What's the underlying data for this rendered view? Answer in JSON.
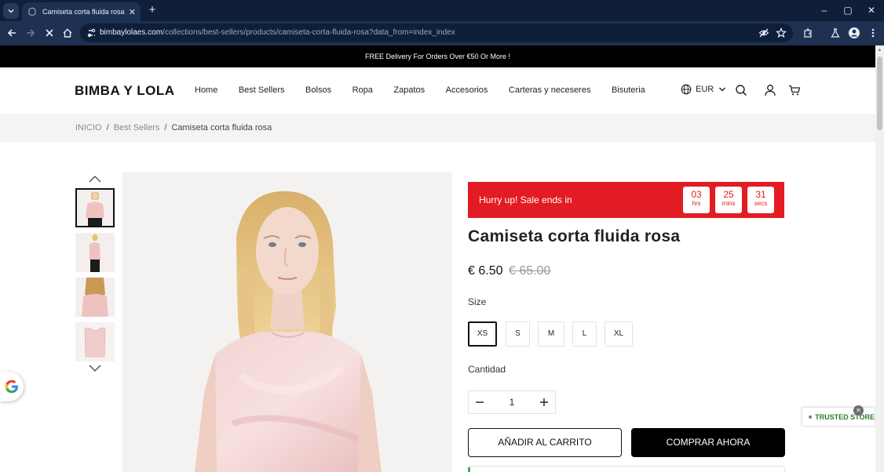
{
  "browser": {
    "tab_title": "Camiseta corta fluida rosa",
    "url_domain": "bimbaylolaes.com",
    "url_path": "/collections/best-sellers/products/camiseta-corta-fluida-rosa?data_from=index_index",
    "new_tab_symbol": "+",
    "close_symbol": "✕",
    "window_controls": {
      "minimize": "–",
      "maximize": "▢",
      "close": "✕"
    }
  },
  "announcement": {
    "text": "FREE Delivery For Orders Over €50 Or More !"
  },
  "header": {
    "logo": "BIMBA Y LOLA",
    "nav": [
      "Home",
      "Best Sellers",
      "Bolsos",
      "Ropa",
      "Zapatos",
      "Accesorios",
      "Carteras y neceseres",
      "Bisuteria"
    ],
    "currency": "EUR"
  },
  "breadcrumb": {
    "home": "INICIO",
    "category": "Best Sellers",
    "current": "Camiseta corta fluida rosa",
    "separator": "/"
  },
  "gallery": {
    "thumbnails": [
      "thumb-front",
      "thumb-side",
      "thumb-back",
      "thumb-flat"
    ],
    "active_index": 0
  },
  "countdown": {
    "label": "Hurry up!  Sale ends in",
    "hours": "03",
    "hours_unit": "hrs",
    "mins": "25",
    "mins_unit": "mins",
    "secs": "31",
    "secs_unit": "secs"
  },
  "product": {
    "title": "Camiseta corta fluida rosa",
    "price": "€ 6.50",
    "compare_price": "€ 65.00",
    "size_label": "Size",
    "sizes": [
      "XS",
      "S",
      "M",
      "L",
      "XL"
    ],
    "selected_size": "XS",
    "quantity_label": "Cantidad",
    "quantity": "1",
    "add_to_cart": "AÑADIR AL CARRITO",
    "buy_now": "COMPRAR AHORA"
  },
  "trust": {
    "label": "TRUSTED STORE",
    "close_symbol": "✕"
  },
  "colors": {
    "sale_red": "#e31b23",
    "black": "#000000",
    "trusted_green": "#2e7d32",
    "breadcrumb_bg": "#f4f4f4"
  }
}
